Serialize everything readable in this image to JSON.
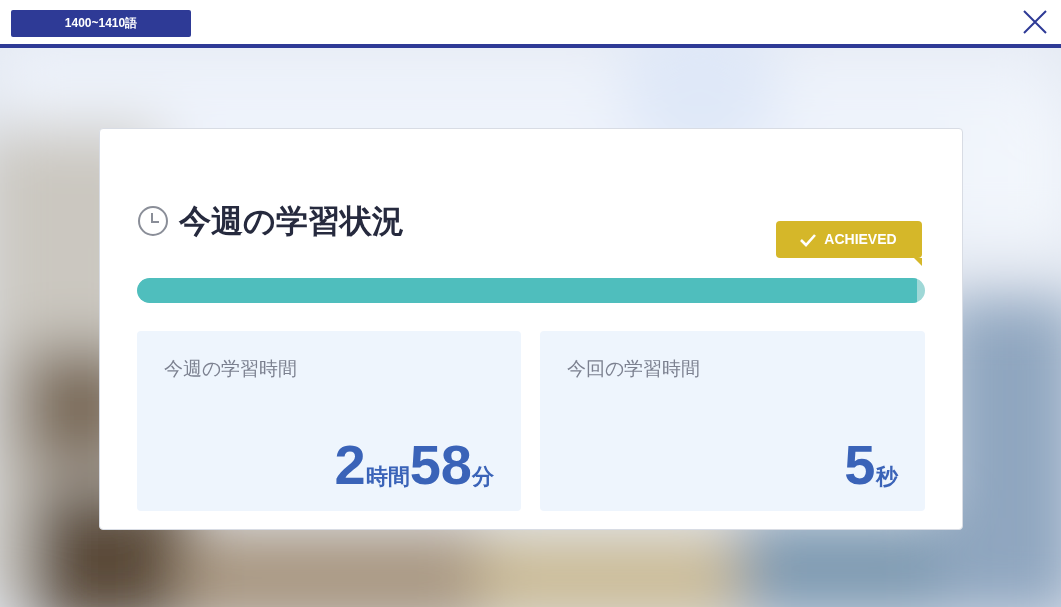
{
  "header": {
    "range_label": "1400~1410語"
  },
  "status_card": {
    "title": "今週の学習状況",
    "achieved": true,
    "badge": "ACHIEVED",
    "progress": {
      "level": 0.99
    },
    "stats": [
      {
        "label": "今週の学習時間",
        "value": [
          {
            "kind": "number",
            "text": "2"
          },
          {
            "kind": "unit",
            "text": "時間"
          },
          {
            "kind": "number",
            "text": "58"
          },
          {
            "kind": "unit",
            "text": "分"
          }
        ]
      },
      {
        "label": "今回の学習時間",
        "value": [
          {
            "kind": "number",
            "text": "5"
          },
          {
            "kind": "unit",
            "text": "秒"
          }
        ]
      }
    ]
  }
}
